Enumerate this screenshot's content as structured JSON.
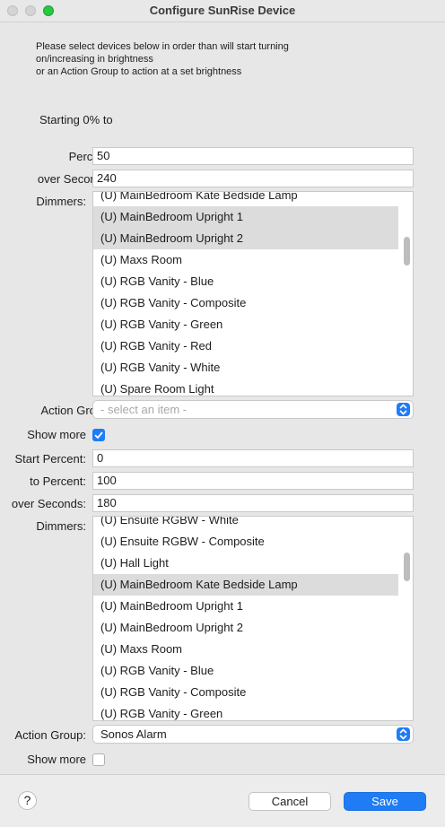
{
  "window": {
    "title": "Configure SunRise Device"
  },
  "intro": {
    "line1": "Please select devices below in order than will start turning",
    "line2": "on/increasing in brightness",
    "line3": "or an Action Group to action at a set brightness"
  },
  "section1": {
    "starting_label": "Starting 0% to",
    "percent_label": "Percent:",
    "percent_value": "50",
    "seconds_label": "over Seconds:",
    "seconds_value": "240",
    "dimmers_label": "Dimmers:",
    "dimmers": [
      {
        "label": "(U) MainBedroom Kate Bedside Lamp",
        "selected": false
      },
      {
        "label": "(U) MainBedroom Upright 1",
        "selected": true
      },
      {
        "label": "(U) MainBedroom Upright 2",
        "selected": true
      },
      {
        "label": "(U) Maxs Room",
        "selected": false
      },
      {
        "label": "(U) RGB Vanity  - Blue",
        "selected": false
      },
      {
        "label": "(U) RGB Vanity - Composite",
        "selected": false
      },
      {
        "label": "(U) RGB Vanity - Green",
        "selected": false
      },
      {
        "label": "(U) RGB Vanity - Red",
        "selected": false
      },
      {
        "label": "(U) RGB Vanity - White",
        "selected": false
      },
      {
        "label": "(U) Spare Room Light",
        "selected": false
      }
    ],
    "action_group_label": "Action Group:",
    "action_group_value": "- select an item -",
    "show_more_label": "Show more",
    "show_more_checked": true
  },
  "section2": {
    "start_percent_label": "Start Percent:",
    "start_percent_value": "0",
    "to_percent_label": "to Percent:",
    "to_percent_value": "100",
    "seconds_label": "over Seconds:",
    "seconds_value": "180",
    "dimmers_label": "Dimmers:",
    "dimmers": [
      {
        "label": "(U) Ensuite RGBW  - White",
        "selected": false
      },
      {
        "label": "(U) Ensuite RGBW - Composite",
        "selected": false
      },
      {
        "label": "(U) Hall Light",
        "selected": false
      },
      {
        "label": "(U) MainBedroom Kate Bedside Lamp",
        "selected": true
      },
      {
        "label": "(U) MainBedroom Upright 1",
        "selected": false
      },
      {
        "label": "(U) MainBedroom Upright 2",
        "selected": false
      },
      {
        "label": "(U) Maxs Room",
        "selected": false
      },
      {
        "label": "(U) RGB Vanity  - Blue",
        "selected": false
      },
      {
        "label": "(U) RGB Vanity - Composite",
        "selected": false
      },
      {
        "label": "(U) RGB Vanity - Green",
        "selected": false
      }
    ],
    "action_group_label": "Action Group:",
    "action_group_value": "Sonos Alarm",
    "show_more_label": "Show more",
    "show_more_checked": false
  },
  "footer": {
    "help_label": "?",
    "cancel_label": "Cancel",
    "save_label": "Save"
  },
  "colors": {
    "accent": "#1f7cf5",
    "selection": "#dcdcdc"
  }
}
